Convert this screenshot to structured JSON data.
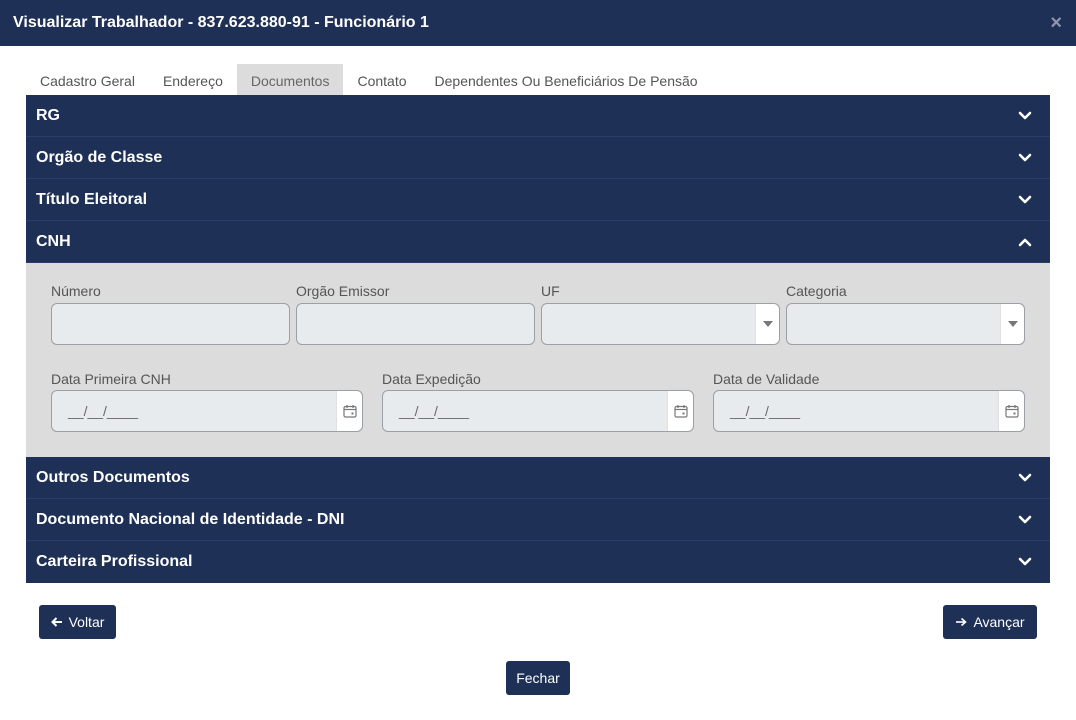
{
  "window": {
    "title": "Visualizar Trabalhador - 837.623.880-91 - Funcionário 1",
    "close_glyph": "×"
  },
  "tabs": [
    {
      "label": "Cadastro Geral"
    },
    {
      "label": "Endereço"
    },
    {
      "label": "Documentos",
      "active": true
    },
    {
      "label": "Contato"
    },
    {
      "label": "Dependentes Ou Beneficiários De Pensão"
    }
  ],
  "sections": {
    "rg": "RG",
    "orgao_classe": "Orgão de Classe",
    "titulo_eleitoral": "Título Eleitoral",
    "cnh": "CNH",
    "outros": "Outros Documentos",
    "dni": "Documento Nacional de Identidade - DNI",
    "carteira": "Carteira Profissional"
  },
  "cnh": {
    "numero_label": "Número",
    "numero_value": "",
    "orgao_label": "Orgão Emissor",
    "orgao_value": "",
    "uf_label": "UF",
    "uf_value": "",
    "categoria_label": "Categoria",
    "categoria_value": "",
    "data_primeira_label": "Data Primeira CNH",
    "data_primeira_value": "__/__/____",
    "data_expedicao_label": "Data Expedição",
    "data_expedicao_value": "__/__/____",
    "data_validade_label": "Data de Validade",
    "data_validade_value": "__/__/____"
  },
  "buttons": {
    "voltar": "Voltar",
    "avancar": "Avançar",
    "fechar": "Fechar"
  },
  "colors": {
    "primary": "#1f3057",
    "panel": "#dcdcdc"
  }
}
